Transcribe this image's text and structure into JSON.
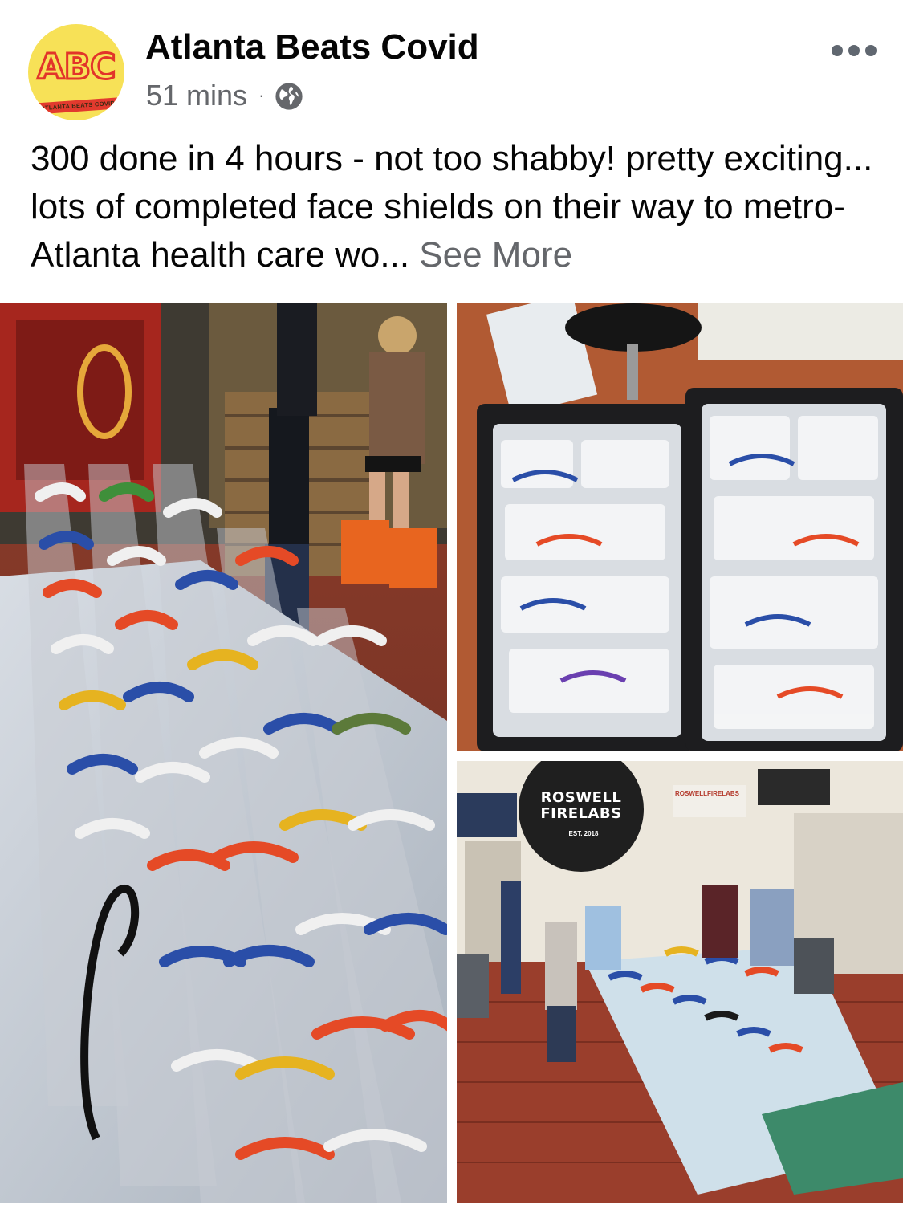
{
  "page": {
    "name": "Atlanta Beats Covid",
    "avatar_letters": "ABC",
    "avatar_subtitle": "ATLANTA BEATS COVID",
    "time": "51 mins",
    "separator": "·",
    "privacy_icon": "globe-icon",
    "more_icon": "more-options-icon"
  },
  "post": {
    "text": "300 done in 4 hours - not too shabby! pretty exciting... lots of completed face shields on their way to metro-Atlanta health care wo...",
    "see_more": "See More"
  },
  "photos": {
    "sign_text": "ROSWELL FIRELABS",
    "sign_est": "EST. 2018",
    "sign_right": "ROSWELLFIRELABS"
  },
  "colors": {
    "avatar_bg": "#f7e157",
    "avatar_red": "#e2342a",
    "secondary_text": "#65676b"
  }
}
